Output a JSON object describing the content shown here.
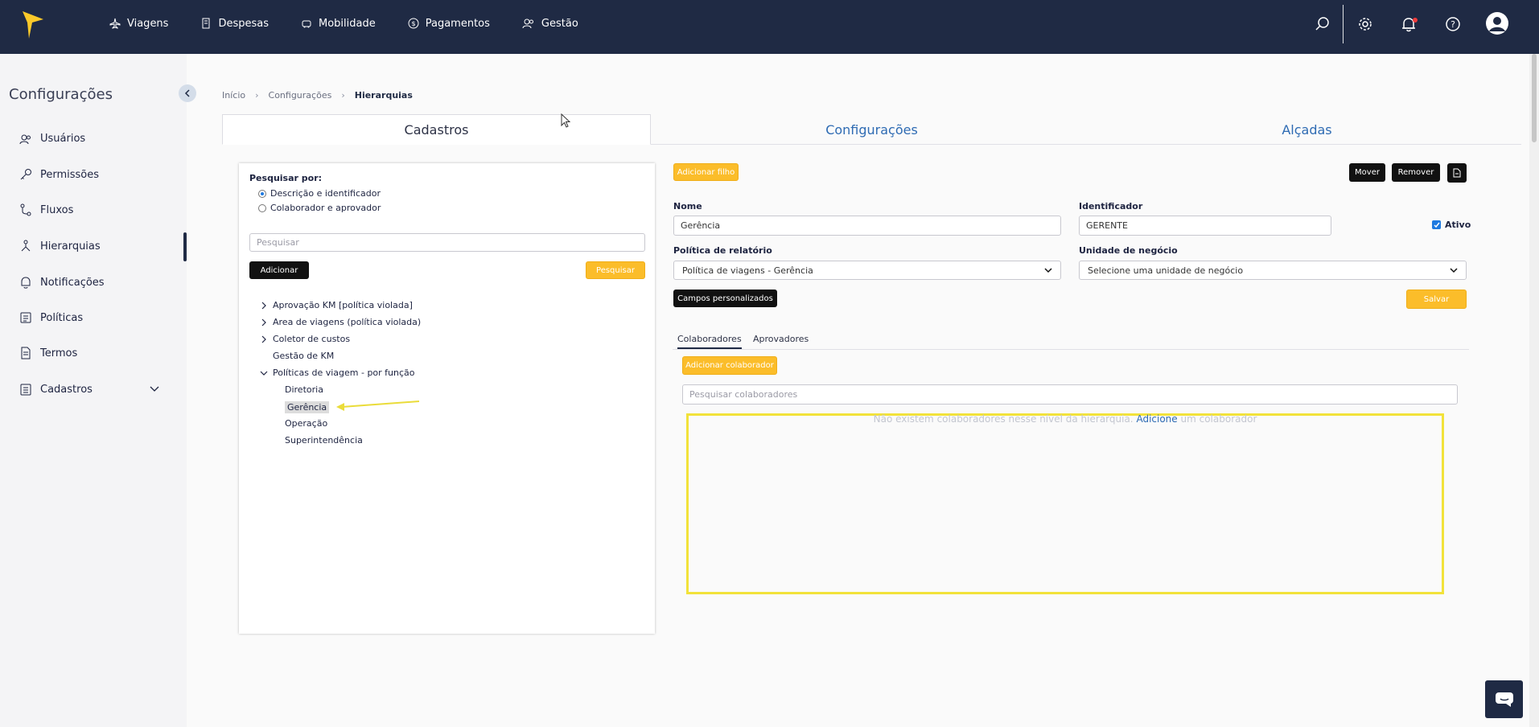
{
  "nav": {
    "items": [
      {
        "label": "Viagens",
        "icon": "plane-icon"
      },
      {
        "label": "Despesas",
        "icon": "receipt-icon"
      },
      {
        "label": "Mobilidade",
        "icon": "car-icon"
      },
      {
        "label": "Pagamentos",
        "icon": "dollar-icon"
      },
      {
        "label": "Gestão",
        "icon": "users-icon"
      }
    ]
  },
  "sidebar": {
    "title": "Configurações",
    "items": [
      {
        "label": "Usuários",
        "icon": "users-icon"
      },
      {
        "label": "Permissões",
        "icon": "key-icon"
      },
      {
        "label": "Fluxos",
        "icon": "flow-icon"
      },
      {
        "label": "Hierarquias",
        "icon": "hierarchy-icon"
      },
      {
        "label": "Notificações",
        "icon": "bell-icon"
      },
      {
        "label": "Políticas",
        "icon": "policy-icon"
      },
      {
        "label": "Termos",
        "icon": "document-icon"
      },
      {
        "label": "Cadastros",
        "icon": "list-icon"
      }
    ],
    "active": "Hierarquias"
  },
  "breadcrumb": {
    "home": "Início",
    "section": "Configurações",
    "current": "Hierarquias"
  },
  "tabs": {
    "cadastros": "Cadastros",
    "configuracoes": "Configurações",
    "alcadas": "Alçadas"
  },
  "search": {
    "label": "Pesquisar por:",
    "option1": "Descrição e identificador",
    "option2": "Colaborador e aprovador",
    "placeholder": "Pesquisar",
    "add_button": "Adicionar",
    "search_button": "Pesquisar"
  },
  "tree": {
    "items": [
      "Aprovação KM [política violada]",
      "Area de viagens (política violada)",
      "Coletor de custos",
      "Gestão de KM",
      "Políticas de viagem - por função"
    ],
    "children": [
      "Diretoria",
      "Gerência",
      "Operação",
      "Superintendência"
    ],
    "selected": "Gerência"
  },
  "detail": {
    "add_child": "Adicionar filho",
    "move": "Mover",
    "remove": "Remover",
    "name_label": "Nome",
    "name_value": "Gerência",
    "id_label": "Identificador",
    "id_value": "GERENTE",
    "active_label": "Ativo",
    "policy_label": "Política de relatório",
    "policy_value": "Política de viagens - Gerência",
    "unit_label": "Unidade de negócio",
    "unit_value": "Selecione uma unidade de negócio",
    "custom_fields": "Campos personalizados",
    "save": "Salvar"
  },
  "collab": {
    "tab1": "Colaboradores",
    "tab2": "Aprovadores",
    "add_button": "Adicionar colaborador",
    "search_placeholder": "Pesquisar colaboradores",
    "empty_before": "Não existem colaboradores nesse nível da hierarquia.",
    "empty_link": "Adicione",
    "empty_after": "um colaborador"
  },
  "colors": {
    "topbar": "#1f2a44",
    "accent_yellow": "#fbbd2a",
    "link_blue": "#2e6bb3",
    "highlight": "#f2e23a"
  }
}
